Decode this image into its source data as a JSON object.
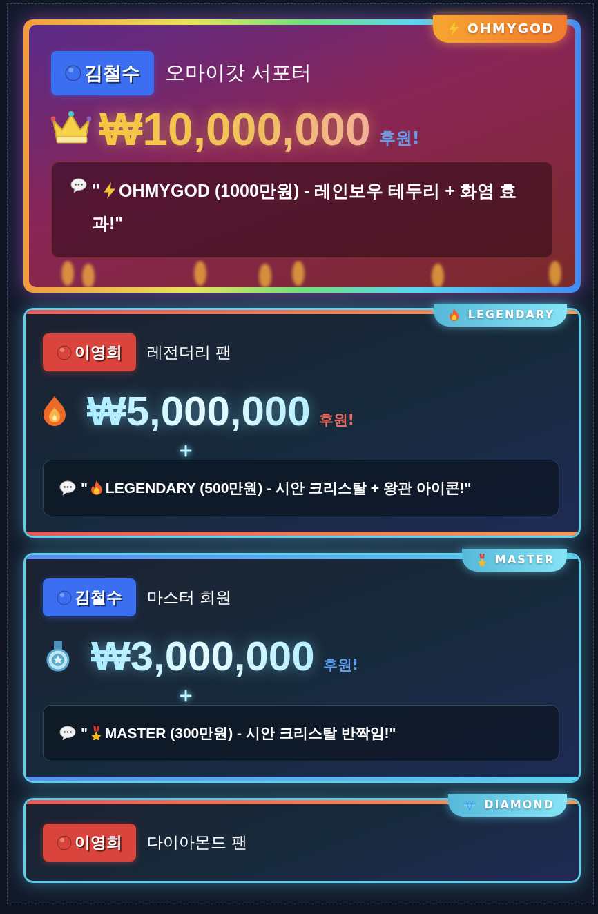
{
  "cards": [
    {
      "kind": "ohmygod",
      "tier_label": "OHMYGOD",
      "user": {
        "name": "김철수",
        "color": "#3b6ef0"
      },
      "subtitle": "오마이갓 서포터",
      "amount": "₩10,000,000",
      "suffix": "후원!",
      "message_open": "\"",
      "message": "OHMYGOD (1000만원) - 레인보우 테두리 + 화염 효과!\""
    },
    {
      "kind": "legendary",
      "tier_label": "LEGENDARY",
      "user": {
        "name": "이영희",
        "color": "#d9453d"
      },
      "subtitle": "레전더리 팬",
      "amount": "₩5,000,000",
      "suffix": "후원!",
      "message_open": "\"",
      "message": "LEGENDARY (500만원) - 시안 크리스탈 + 왕관 아이콘!\""
    },
    {
      "kind": "master",
      "tier_label": "MASTER",
      "user": {
        "name": "김철수",
        "color": "#3b6ef0"
      },
      "subtitle": "마스터 회원",
      "amount": "₩3,000,000",
      "suffix": "후원!",
      "message_open": "\"",
      "message": "MASTER (300만원) - 시안 크리스탈 반짝임!\""
    },
    {
      "kind": "diamond",
      "tier_label": "DIAMOND",
      "user": {
        "name": "이영희",
        "color": "#d9453d"
      },
      "subtitle": "다이아몬드 팬"
    }
  ]
}
